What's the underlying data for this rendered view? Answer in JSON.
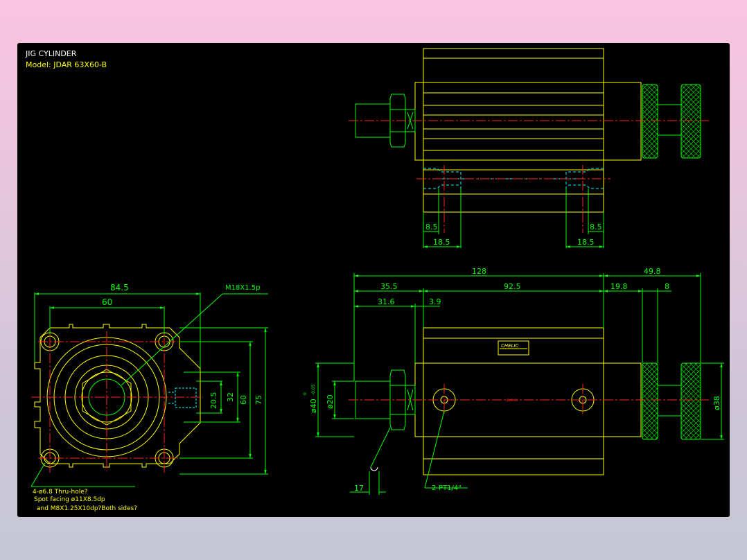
{
  "title": {
    "line1": "JIG CYLINDER",
    "line2": "Model: JDAR 63X60-B"
  },
  "colors": {
    "outline": "#ffff00",
    "dim": "#00ff00",
    "center": "#ff2020",
    "hidden": "#00ffff",
    "bg": "#000000"
  },
  "top_view": {
    "dims": {
      "left_small": "8.5",
      "right_small": "8.5",
      "left_large": "18.5",
      "right_large": "18.5"
    }
  },
  "left_view": {
    "dims": {
      "width_overall": "84.5",
      "hole_span": "60",
      "h1": "20.5",
      "h2": "32",
      "h3": "60",
      "h4": "75"
    },
    "thread_label": "M18X1.5p",
    "notes": {
      "n1": "4-ø6.8  Thru-hole?",
      "n2": "Spot facing  ø11X8.5dp",
      "n3": "and M8X1.25X10dp?Both sides?"
    }
  },
  "front_view": {
    "dims": {
      "total": "128",
      "knob_total": "49.8",
      "d35": "35.5",
      "d92": "92.5",
      "d19": "19.8",
      "d8": "8",
      "d31": "31.6",
      "d3": "3.9",
      "dia20": "ø20",
      "dia40": "ø40",
      "tol_top": "0",
      "tol_bot": "-0.05",
      "dia38": "ø38",
      "wrench": "17",
      "port": "2-PT1/4\"",
      "tiny": "JDAR 63"
    },
    "brand": "CHELIC"
  }
}
